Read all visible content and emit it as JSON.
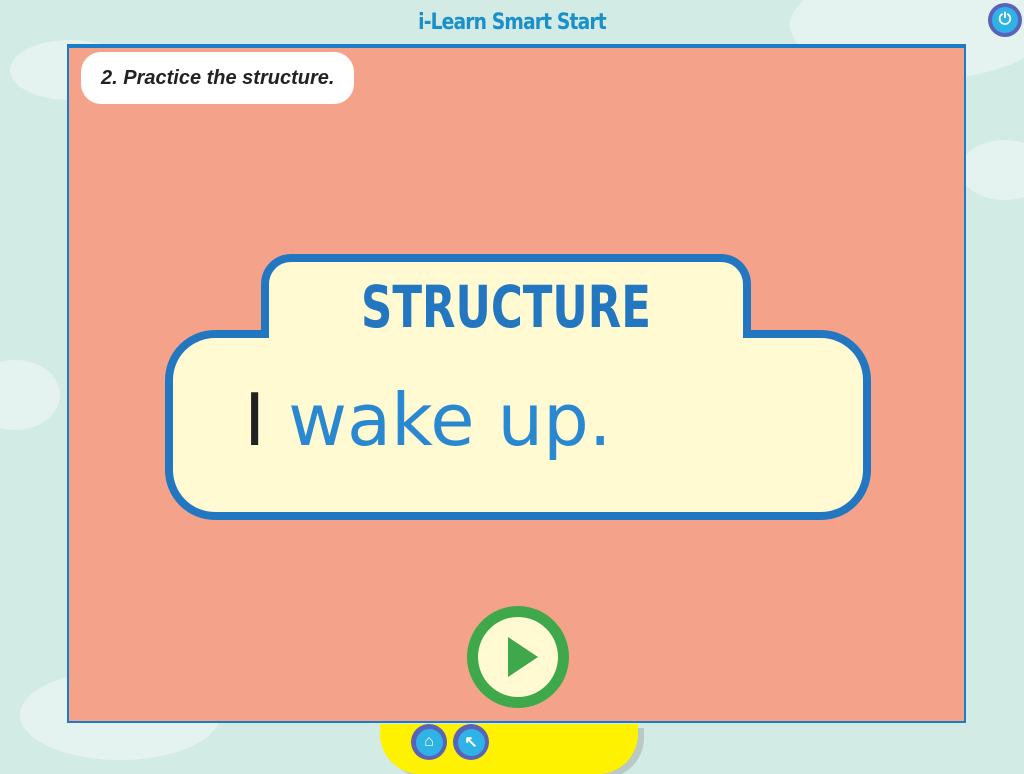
{
  "app": {
    "title": "i-Learn Smart Start"
  },
  "instruction": "2. Practice the structure.",
  "card": {
    "heading": "STRUCTURE",
    "subject": "I",
    "rest": " wake up."
  },
  "icons": {
    "power": "power-icon",
    "play": "play-icon",
    "home": "home-icon",
    "back": "back-arrow-icon"
  },
  "glyphs": {
    "power": "⏻",
    "home": "⌂",
    "back": "↖"
  }
}
